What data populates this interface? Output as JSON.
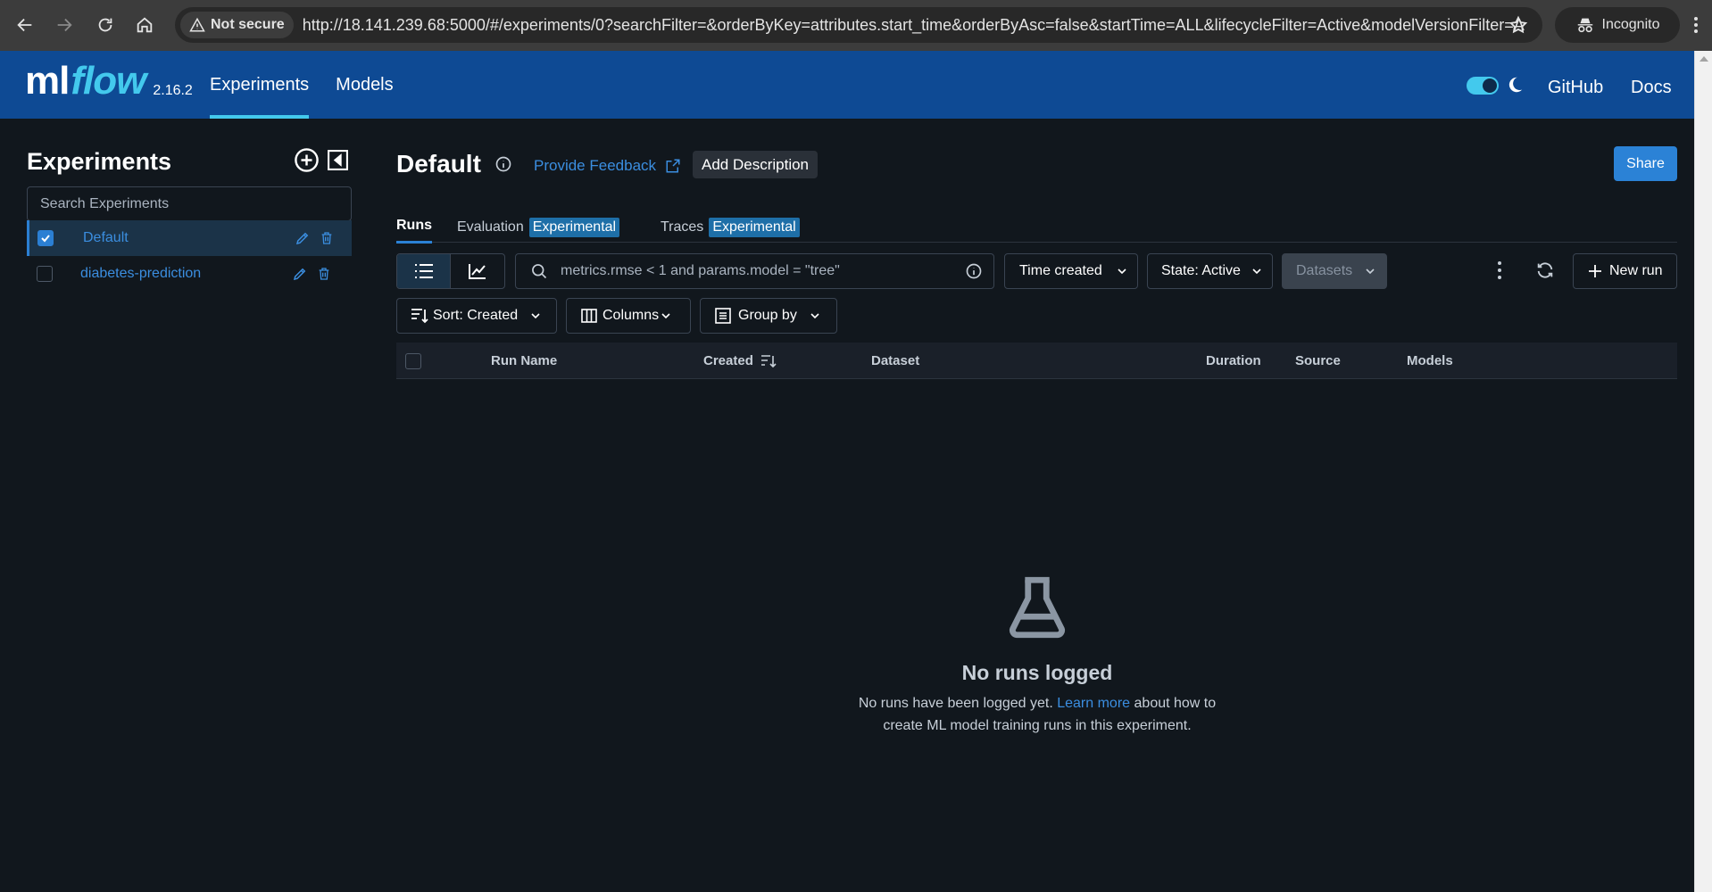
{
  "browser": {
    "security_label": "Not secure",
    "url": "http://18.141.239.68:5000/#/experiments/0?searchFilter=&orderByKey=attributes.start_time&orderByAsc=false&startTime=ALL&lifecycleFilter=Active&modelVersionFilter=A...",
    "incognito_label": "Incognito"
  },
  "header": {
    "logo_ml": "ml",
    "logo_flow": "flow",
    "version": "2.16.2",
    "nav": [
      "Experiments",
      "Models"
    ],
    "github": "GitHub",
    "docs": "Docs"
  },
  "sidebar": {
    "title": "Experiments",
    "search_placeholder": "Search Experiments",
    "experiments": [
      {
        "name": "Default",
        "checked": true
      },
      {
        "name": "diabetes-prediction",
        "checked": false
      }
    ]
  },
  "main": {
    "title": "Default",
    "feedback": "Provide Feedback",
    "add_description": "Add Description",
    "share": "Share",
    "tabs": [
      {
        "label": "Runs",
        "tag": ""
      },
      {
        "label": "Evaluation",
        "tag": "Experimental"
      },
      {
        "label": "Traces",
        "tag": "Experimental"
      }
    ],
    "search_placeholder": "metrics.rmse < 1 and params.model = \"tree\"",
    "time_filter": "Time created",
    "state_filter": "State: Active",
    "datasets_filter": "Datasets",
    "new_run": "New run",
    "sort": "Sort: Created",
    "columns": "Columns",
    "group_by": "Group by",
    "table_columns": [
      "Run Name",
      "Created",
      "Dataset",
      "Duration",
      "Source",
      "Models"
    ],
    "empty_title": "No runs logged",
    "empty_desc_before": "No runs have been logged yet.",
    "empty_link": "Learn more",
    "empty_desc_after1": "about how to",
    "empty_desc_after2": "create ML model training runs in this experiment."
  }
}
